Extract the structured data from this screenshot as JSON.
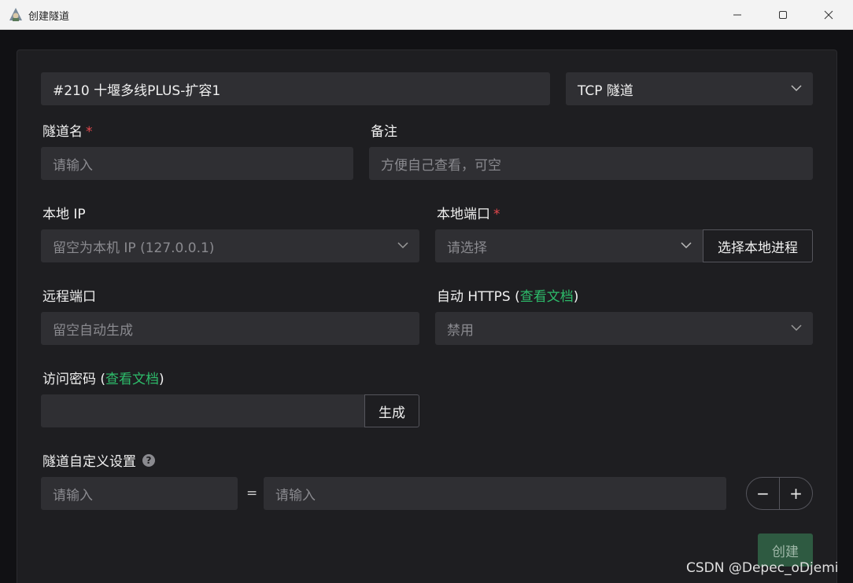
{
  "window": {
    "title": "创建隧道"
  },
  "node_select": {
    "value": "#210 十堰多线PLUS-扩容1"
  },
  "type_select": {
    "value": "TCP 隧道"
  },
  "tunnel_name": {
    "label": "隧道名",
    "required": "*",
    "placeholder": "请输入"
  },
  "remark": {
    "label": "备注",
    "placeholder": "方便自己查看，可空"
  },
  "local_ip": {
    "label": "本地 IP",
    "placeholder": "留空为本机 IP (127.0.0.1)"
  },
  "local_port": {
    "label": "本地端口",
    "required": "*",
    "placeholder": "请选择",
    "pick_button": "选择本地进程"
  },
  "remote_port": {
    "label": "远程端口",
    "placeholder": "留空自动生成"
  },
  "auto_https": {
    "label_prefix": "自动 HTTPS (",
    "link": "查看文档",
    "label_suffix": ")",
    "value": "禁用"
  },
  "access_password": {
    "label_prefix": "访问密码 (",
    "link": "查看文档",
    "label_suffix": ")",
    "value": "",
    "generate_button": "生成"
  },
  "custom_settings": {
    "label": "隧道自定义设置",
    "help": "?",
    "key_placeholder": "请输入",
    "equals": "=",
    "value_placeholder": "请输入",
    "minus": "−",
    "plus": "+"
  },
  "create_button": "创建",
  "watermark": "CSDN @Depec_oDjemi",
  "colors": {
    "accent": "#2dbb6a",
    "required": "#e5484d",
    "background": "#1e1e21",
    "field": "#2f2f33"
  }
}
